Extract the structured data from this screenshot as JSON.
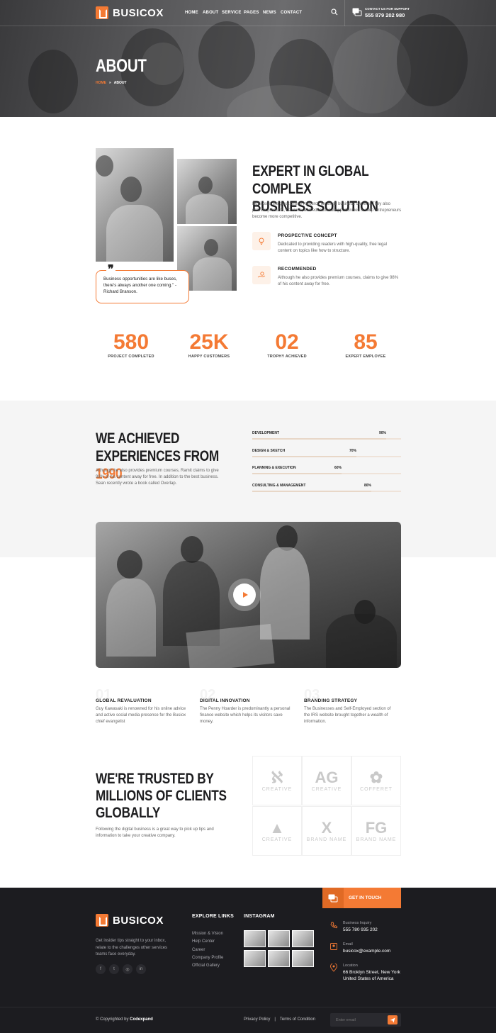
{
  "brand": {
    "name": "BUSICOX",
    "accent": "#f47a34",
    "dark": "#1c1c20"
  },
  "nav": {
    "items": [
      "HOME",
      "ABOUT",
      "SERVICE",
      "PAGES",
      "NEWS",
      "CONTACT"
    ],
    "support_label": "CONTACT US FOR SUPPORT",
    "support_phone": "555 879 202 980"
  },
  "hero": {
    "title": "ABOUT",
    "breadcrumb_home": "HOME",
    "breadcrumb_sep": "»",
    "breadcrumb_current": "ABOUT"
  },
  "expert": {
    "title_line1": "EXPERT IN GLOBAL COMPLEX",
    "title_line2": "BUSINESS SOLUTION",
    "description": "Busicox is the great online resource for small business owners. They also provide products, services, and educational opportunities to help entrepreneurs become more competitive.",
    "quote": "Business opportunities are like buses, there's always another one coming.\" - Richard Branson.",
    "features": [
      {
        "icon": "lightbulb-icon",
        "title": "PROSPECTIVE CONCEPT",
        "text": "Dedicated to providing readers with high-quality, free legal content on topics like how to structure."
      },
      {
        "icon": "hand-coin-icon",
        "title": "RECOMMENDED",
        "text": "Although he also provides premium courses, claims to give 98% of his content away for free."
      }
    ]
  },
  "counters": [
    {
      "value": "580",
      "label": "PROJECT COMPLETED"
    },
    {
      "value": "25K",
      "label": "HAPPY CUSTOMERS"
    },
    {
      "value": "02",
      "label": "TROPHY ACHIEVED"
    },
    {
      "value": "85",
      "label": "EXPERT EMPLOYEE"
    }
  ],
  "experience": {
    "title_line1": "WE ACHIEVED",
    "title_line2_prefix": "EXPERIENCES FROM ",
    "title_year": "1990",
    "description": "Although he also provides premium courses, Ramit claims to give 98% of his content away for free. In addition to the best business. Sean recently wrote a book called Overlap.",
    "skills": [
      {
        "label": "DEVELOPMENT",
        "percent": 90,
        "percent_text": "90%"
      },
      {
        "label": "DESIGN & SKETCH",
        "percent": 70,
        "percent_text": "70%"
      },
      {
        "label": "PLANNING & EXECUTION",
        "percent": 60,
        "percent_text": "60%"
      },
      {
        "label": "CONSULTING & MANAGEMENT",
        "percent": 80,
        "percent_text": "80%"
      }
    ]
  },
  "services": [
    {
      "num": "01",
      "title": "GLOBAL REVALUATION",
      "text": "Guy Kawasaki is renowned for his online advice and active social media presence for the Busiox chief evangelist"
    },
    {
      "num": "02",
      "title": "DIGITAL INNOVATION",
      "text": "The Penny Hoarder is predominantly a personal finance website which helps its visitors save money."
    },
    {
      "num": "03",
      "title": "BRANDING STRATEGY",
      "text": "The Businesses and Self-Employed section of the IRS website brought together a wealth of information."
    }
  ],
  "clients": {
    "title_line1": "WE'RE TRUSTED BY",
    "title_line2": "MILLIONS OF CLIENTS",
    "title_line3": "GLOBALLY",
    "description": "Following the digital business is a great way to pick up tips and information to take your creative company.",
    "logos": [
      {
        "glyph": "ℵ",
        "name": "CREATIVE"
      },
      {
        "glyph": "AG",
        "name": "CREATIVE"
      },
      {
        "glyph": "✿",
        "name": "COFFERET"
      },
      {
        "glyph": "▲",
        "name": "CREATIVE"
      },
      {
        "glyph": "X",
        "name": "BRAND NAME"
      },
      {
        "glyph": "FG",
        "name": "BRAND NAME"
      }
    ]
  },
  "footer": {
    "about": "Get insider tips straight to your inbox, relate to the challenges other services teams face everyday.",
    "social": [
      "f",
      "t",
      "◎",
      "in"
    ],
    "explore_title": "EXPLORE LINKS",
    "explore_links": [
      "Mission & Vision",
      "Help Center",
      "Career",
      "Company Profile",
      "Official Gallery"
    ],
    "instagram_title": "INSTAGRAM",
    "get_in_touch": "GET IN TOUCH",
    "contacts": [
      {
        "icon": "phone-icon",
        "label": "Business Inquiry",
        "value": "555 780 935 202"
      },
      {
        "icon": "email-icon",
        "label": "Email",
        "value": "busicox@example.com"
      },
      {
        "icon": "location-icon",
        "label": "Location",
        "value": "66 Broklyn Street, New York United States of America"
      }
    ],
    "copyright_prefix": "© Copyrighted by ",
    "copyright_brand": "Codexpand",
    "privacy": "Privacy Policy",
    "divider": "|",
    "terms": "Terms of Condition",
    "email_placeholder": "Enter email"
  }
}
